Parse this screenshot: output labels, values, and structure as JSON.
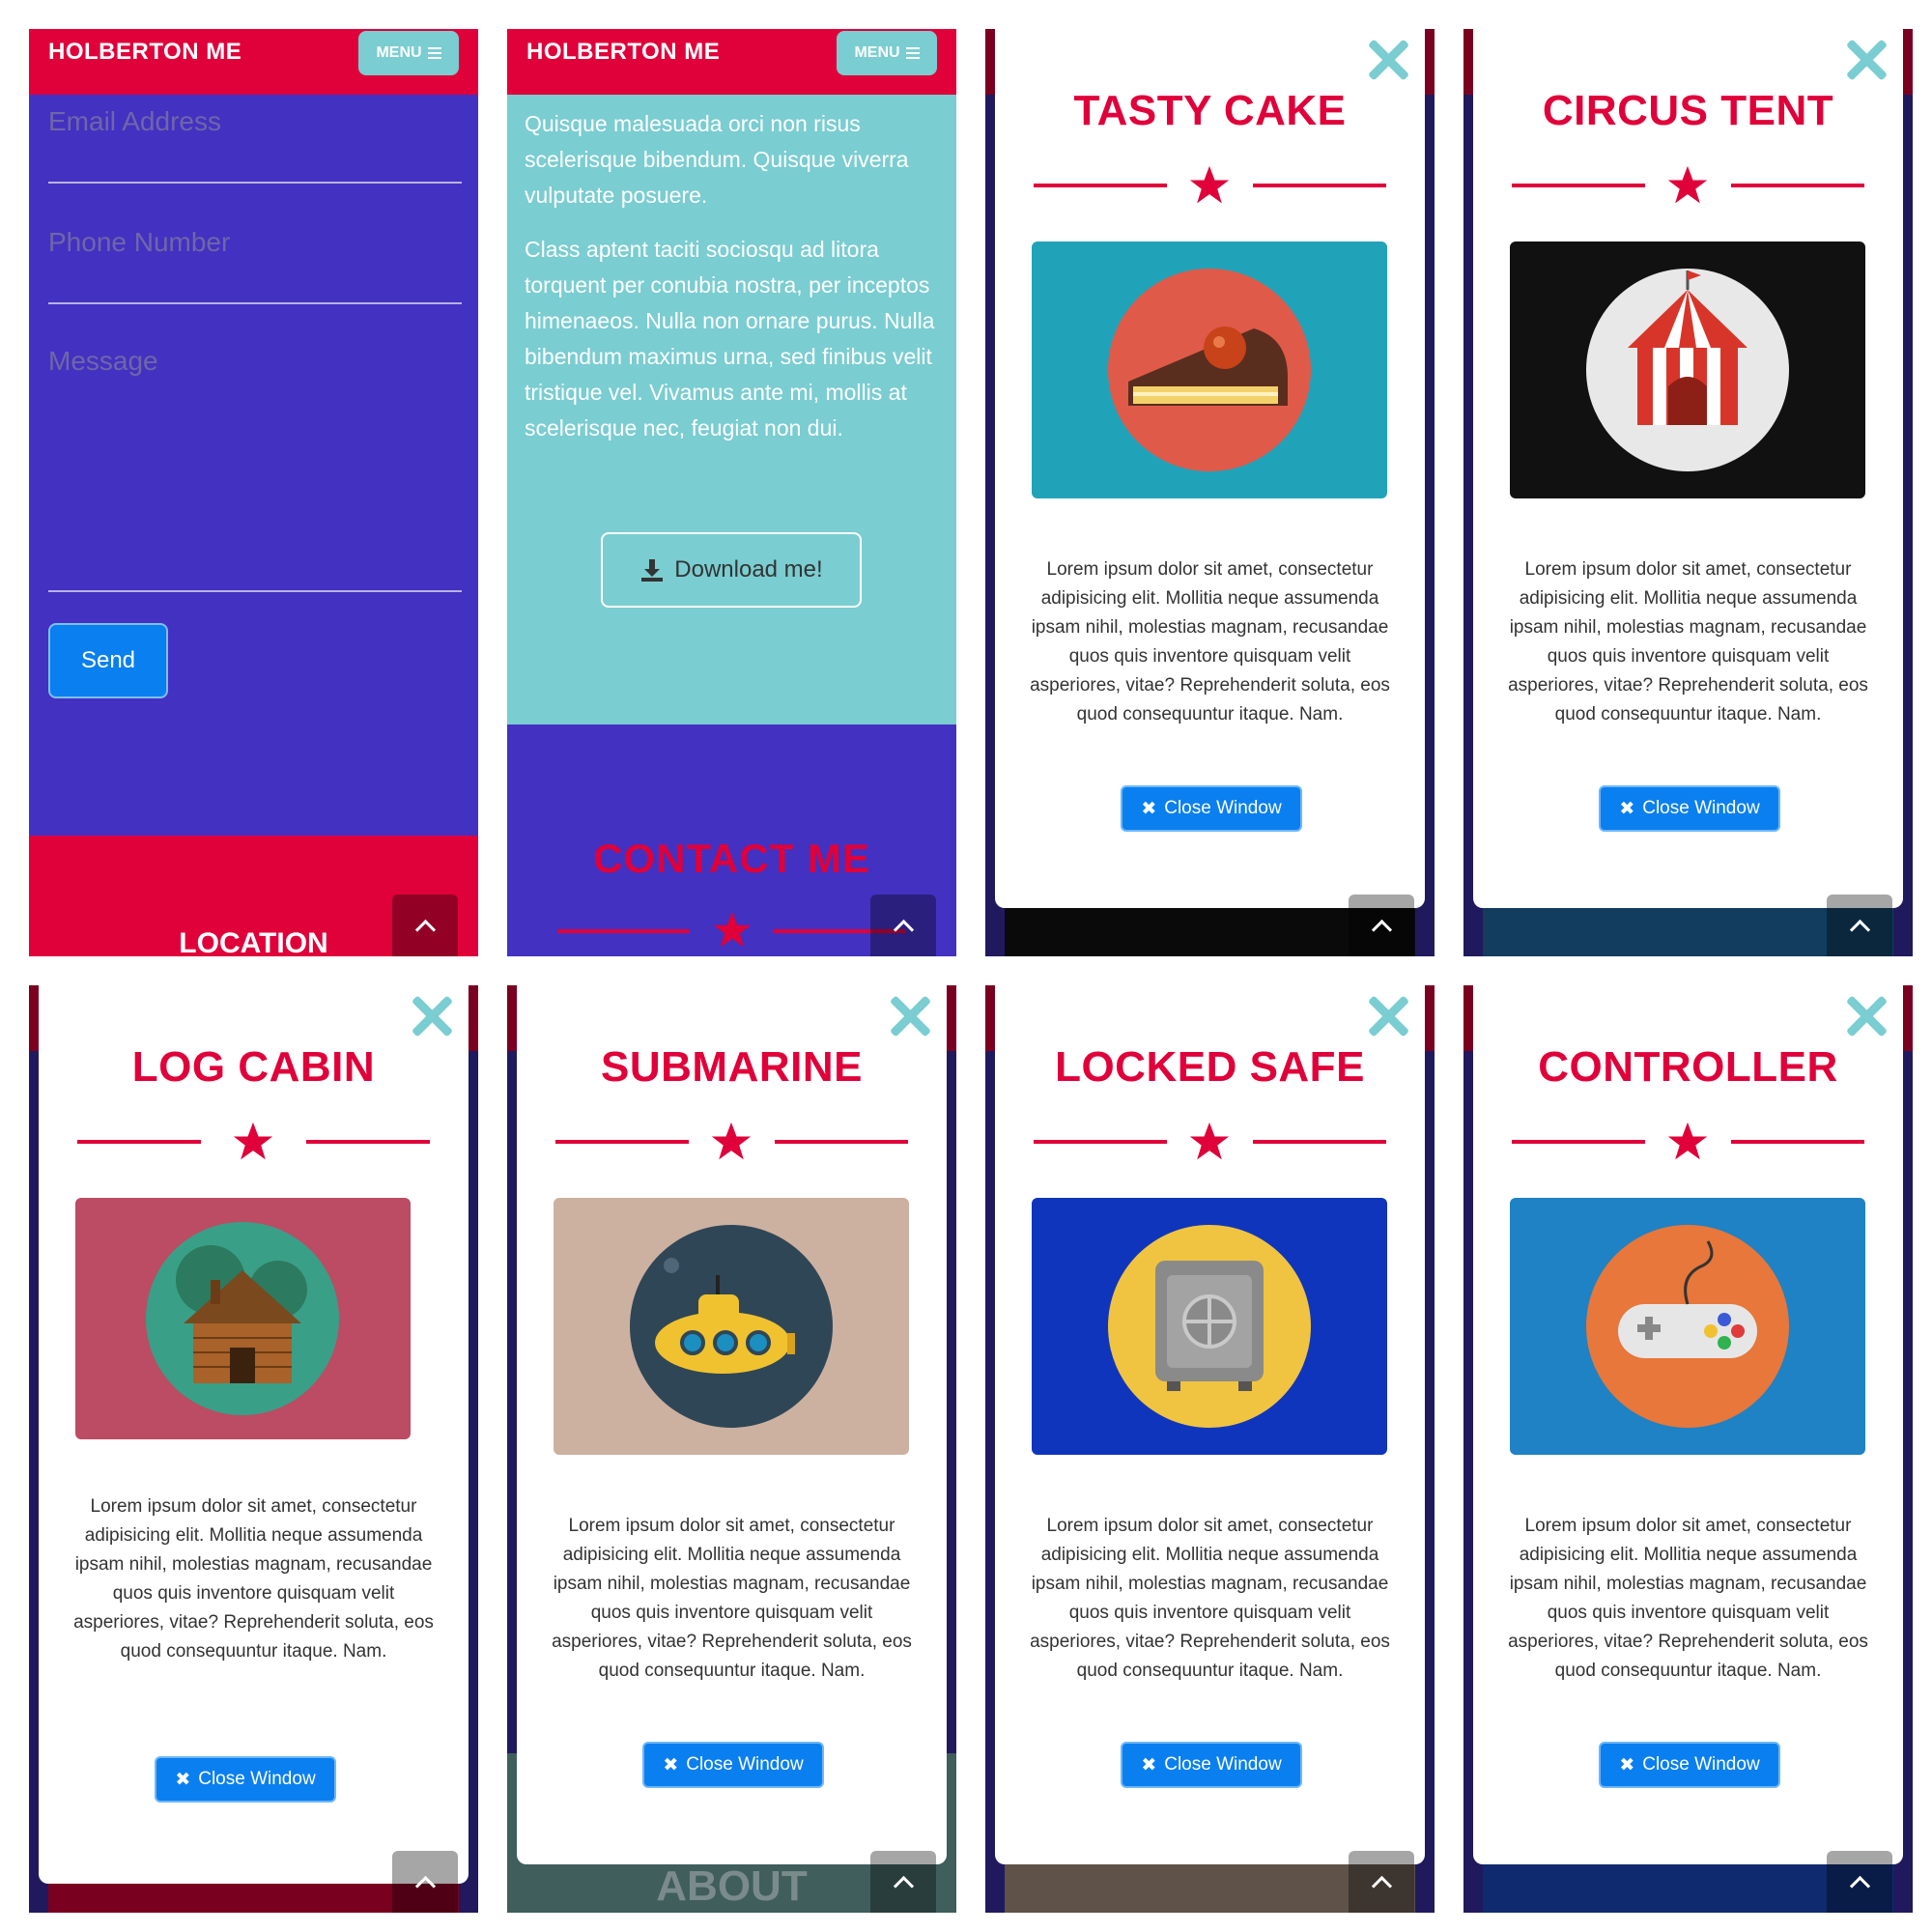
{
  "navbar": {
    "brand": "HOLBERTON ME",
    "menu_label": "MENU"
  },
  "contact_form": {
    "email_placeholder": "Email Address",
    "phone_placeholder": "Phone Number",
    "message_placeholder": "Message",
    "send_label": "Send",
    "location_title": "LOCATION"
  },
  "about": {
    "paragraph1": "Quisque malesuada orci non risus scelerisque bibendum. Quisque viverra vulputate posuere.",
    "paragraph2": "Class aptent taciti sociosqu ad litora torquent per conubia nostra, per inceptos himenaeos. Nulla non ornare purus. Nulla bibendum maximus urna, sed finibus velit tristique vel. Vivamus ante mi, mollis at scelerisque nec, feugiat non dui.",
    "download_label": "Download me!",
    "contact_title": "CONTACT ME",
    "about_peek": "ABOUT"
  },
  "modal_text": "Lorem ipsum dolor sit amet, consectetur adipisicing elit. Mollitia neque assumenda ipsam nihil, molestias magnam, recusandae quos quis inventore quisquam velit asperiores, vitae? Reprehenderit soluta, eos quod consequuntur itaque. Nam.",
  "close_window_label": "Close Window",
  "modals": [
    {
      "title": "TASTY CAKE",
      "icon": "cake-icon",
      "image_bg": "#20a3b8"
    },
    {
      "title": "CIRCUS TENT",
      "icon": "circus-tent-icon",
      "image_bg": "#111111"
    },
    {
      "title": "LOG CABIN",
      "icon": "log-cabin-icon",
      "image_bg": "#bb4c63"
    },
    {
      "title": "SUBMARINE",
      "icon": "submarine-icon",
      "image_bg": "#ccb1a1"
    },
    {
      "title": "LOCKED SAFE",
      "icon": "safe-icon",
      "image_bg": "#1035bd"
    },
    {
      "title": "CONTROLLER",
      "icon": "game-controller-icon",
      "image_bg": "#1e82c4"
    }
  ],
  "colors": {
    "primary_red": "#e0003a",
    "teal": "#7acdd1",
    "purple": "#4331c2",
    "button_blue": "#0a7ff0",
    "navy": "#21195d"
  }
}
